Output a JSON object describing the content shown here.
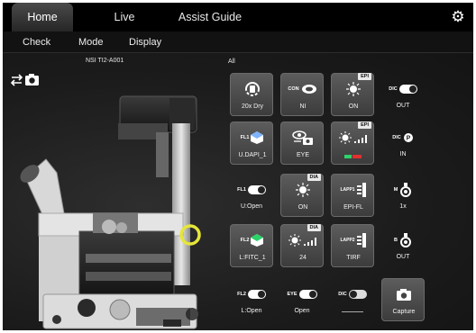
{
  "tabs": [
    {
      "label": "Home",
      "active": true
    },
    {
      "label": "Live",
      "active": false
    },
    {
      "label": "Assist Guide",
      "active": false
    }
  ],
  "submenu": [
    "Check",
    "Mode",
    "Display"
  ],
  "device_name": "NSI TI2-A001",
  "group_label": "All",
  "buttons": {
    "objective": {
      "label": "20x Dry"
    },
    "condenser": {
      "label": "NI",
      "icon_text": "CON"
    },
    "epi_shutter": {
      "label": "ON",
      "badge": "EPI"
    },
    "dic_analyzer": {
      "label": "OUT",
      "icon_text": "DIC"
    },
    "filter1": {
      "label": "U.DAPI_1",
      "icon_text": "FL1"
    },
    "light_path": {
      "label": "EYE"
    },
    "epi_intensity": {
      "label": "",
      "badge": "EPI"
    },
    "dic_prism": {
      "label": "IN",
      "icon_text": "DIC"
    },
    "fl1_shutter": {
      "label": "U:Open",
      "icon_text": "FL1"
    },
    "dia_shutter": {
      "label": "ON",
      "badge": "DIA"
    },
    "lapp1": {
      "label": "EPI-FL",
      "icon_text": "LAPP1"
    },
    "magnifier": {
      "label": "1x",
      "icon_text": "M"
    },
    "filter2": {
      "label": "L:FITC_1",
      "icon_text": "FL2"
    },
    "dia_intensity": {
      "label": "24",
      "badge": "DIA"
    },
    "lapp2": {
      "label": "TIRF",
      "icon_text": "LAPP2"
    },
    "bertrand": {
      "label": "OUT",
      "icon_text": "B"
    },
    "fl2_shutter": {
      "label": "L:Open",
      "icon_text": "FL2"
    },
    "eye_shutter": {
      "label": "Open",
      "icon_text": "EYE"
    },
    "dic_toggle": {
      "label": "",
      "icon_text": "DIC"
    },
    "capture": {
      "label": "Capture"
    }
  },
  "colors": {
    "accent_green": "#2bd36a",
    "accent_red": "#e03030",
    "highlight_ring": "#e6e63a"
  }
}
